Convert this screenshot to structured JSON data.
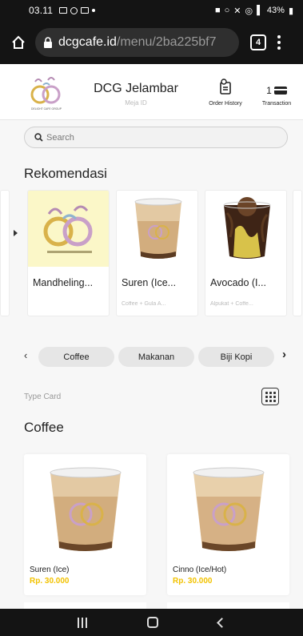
{
  "status_bar": {
    "time": "03.11",
    "battery": "43%"
  },
  "browser": {
    "url_host": "dcgcafe.id",
    "url_path": "/menu/2ba225bf7",
    "tab_count": "4"
  },
  "header": {
    "logo_text": "DELIGHT CAFE GROUP",
    "store_name": "DCG Jelambar",
    "table_label": "Meja ID",
    "order_history_label": "Order History",
    "transaction_count": "1",
    "transaction_label": "Transaction"
  },
  "search": {
    "placeholder": "Search"
  },
  "recommendations": {
    "title": "Rekomendasi",
    "items": [
      {
        "name": "Mandheling...",
        "desc": "",
        "icon": "dcg-logo-image"
      },
      {
        "name": "Suren (Ice...",
        "desc": "Coffee + Gula A...",
        "icon": "iced-latte-image"
      },
      {
        "name": "Avocado (I...",
        "desc": "Alpukat + Coffe...",
        "icon": "avocado-coffee-image"
      }
    ]
  },
  "categories": {
    "items": [
      "Coffee",
      "Makanan",
      "Biji Kopi"
    ]
  },
  "view": {
    "type_label": "Type Card"
  },
  "menu_section": {
    "title": "Coffee",
    "products": [
      {
        "name": "Suren (Ice)",
        "price": "Rp. 30.000"
      },
      {
        "name": "Cinno (Ice/Hot)",
        "price": "Rp. 30.000"
      }
    ]
  },
  "colors": {
    "price": "#f2c200",
    "system_bar": "#141414"
  }
}
